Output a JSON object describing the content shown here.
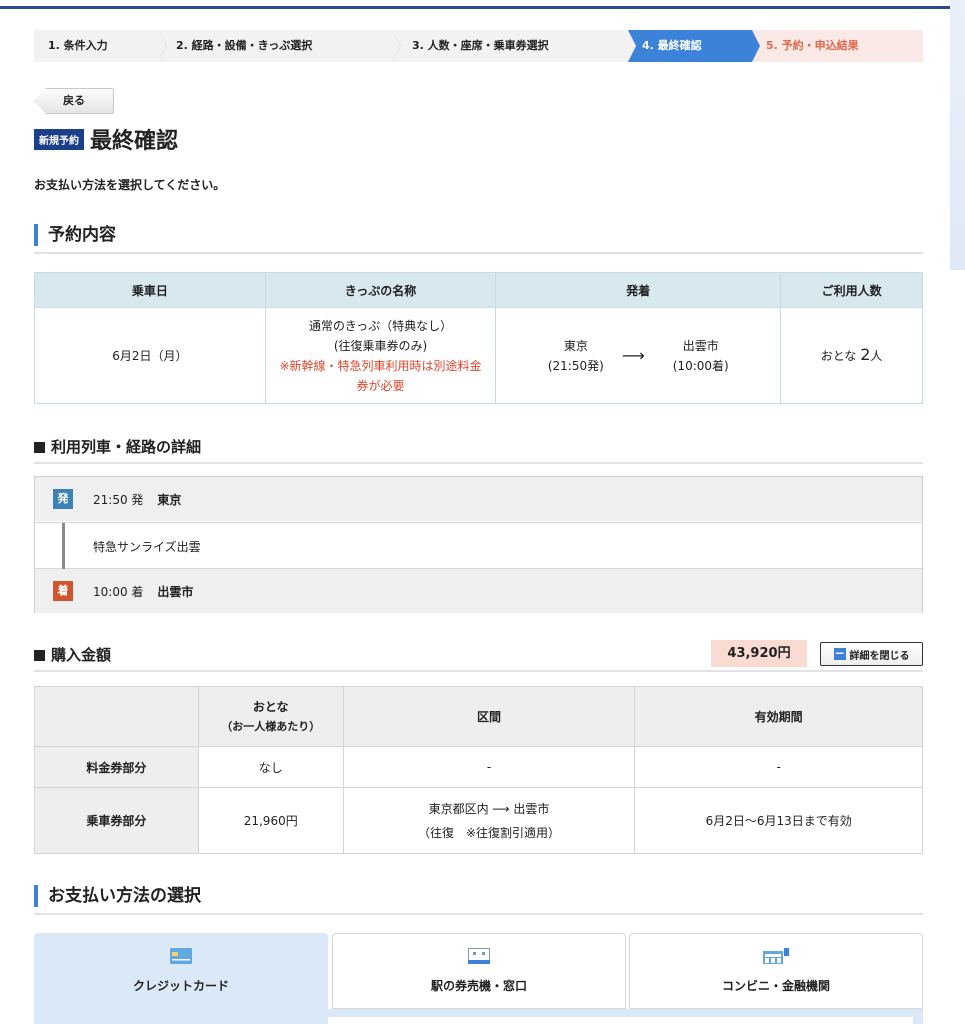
{
  "steps": [
    {
      "label": "1. 条件入力"
    },
    {
      "label": "2. 経路・設備・きっぷ選択"
    },
    {
      "label": "3. 人数・座席・乗車券選択"
    },
    {
      "label": "4. 最終確認"
    },
    {
      "label": "5. 予約・申込結果"
    }
  ],
  "back_label": "戻る",
  "badge": "新規予約",
  "page_title": "最終確認",
  "instruction": "お支払い方法を選択してください。",
  "reservation": {
    "heading": "予約内容",
    "headers": [
      "乗車日",
      "きっぷの名称",
      "発着",
      "ご利用人数"
    ],
    "date": "6月2日（月）",
    "ticket_name_1": "通常のきっぷ（特典なし）",
    "ticket_name_2": "(往復乗車券のみ)",
    "ticket_note": "※新幹線・特急列車利用時は別途料金券が必要",
    "from_station": "東京",
    "from_time": "(21:50発)",
    "to_station": "出雲市",
    "to_time": "(10:00着)",
    "arrow": "⟶",
    "people_prefix": "おとな",
    "people_count": "2",
    "people_suffix": "人"
  },
  "train_detail": {
    "heading": "利用列車・経路の詳細",
    "dep_tag": "発",
    "dep_time": "21:50 発",
    "dep_station": "東京",
    "train_name": "特急サンライズ出雲",
    "arr_tag": "着",
    "arr_time": "10:00 着",
    "arr_station": "出雲市"
  },
  "purchase": {
    "heading": "購入金額",
    "total": "43,920円",
    "close_label": "詳細を閉じる",
    "col_adult": "おとな",
    "col_adult_sub": "（お一人様あたり）",
    "col_section": "区間",
    "col_validity": "有効期間",
    "row1_label": "料金券部分",
    "row1_adult": "なし",
    "row1_section": "-",
    "row1_validity": "-",
    "row2_label": "乗車券部分",
    "row2_adult": "21,960円",
    "row2_section_1": "東京都区内 ⟶ 出雲市",
    "row2_section_2": "（往復　※往復割引適用）",
    "row2_validity": "6月2日〜6月13日まで有効"
  },
  "payment": {
    "heading": "お支払い方法の選択",
    "tabs": [
      {
        "label": "クレジットカード",
        "icon": "credit-card-icon"
      },
      {
        "label": "駅の券売機・窓口",
        "icon": "ticket-machine-icon"
      },
      {
        "label": "コンビニ・金融機関",
        "icon": "convenience-store-icon"
      }
    ]
  }
}
